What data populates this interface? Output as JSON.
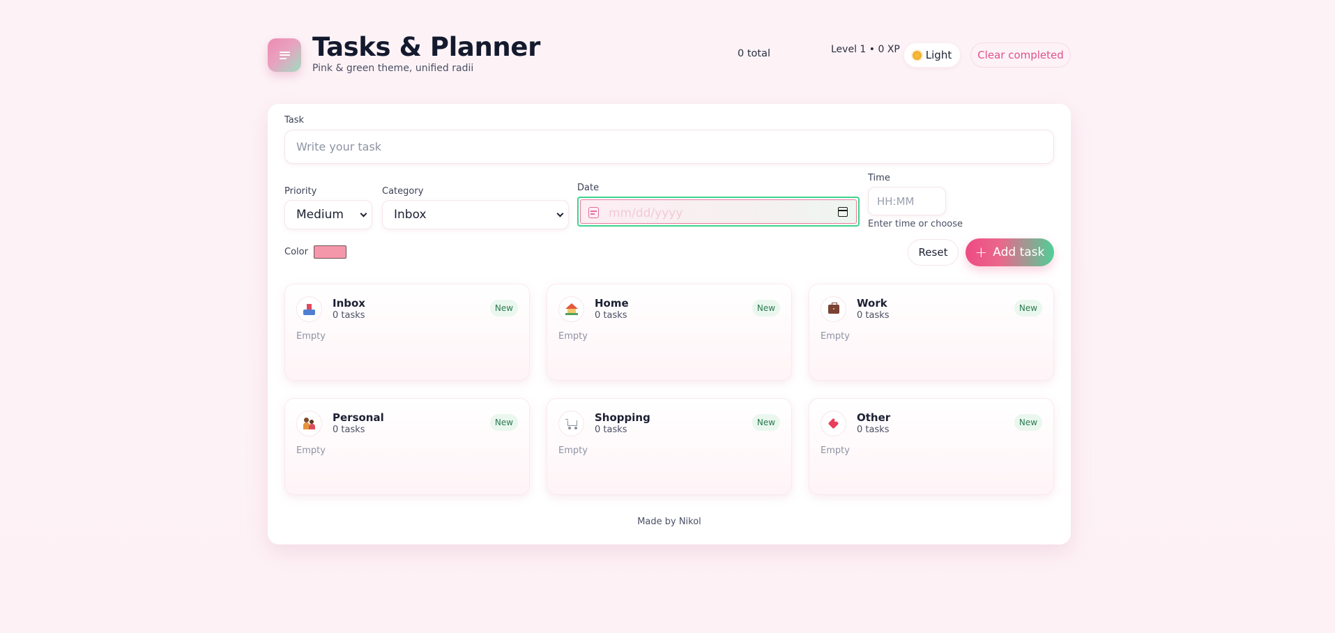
{
  "header": {
    "title": "Tasks & Planner",
    "subtitle": "Pink & green theme, unified radii",
    "total": "0 total",
    "level": "Level 1 • 0 XP",
    "theme_label": "Light",
    "clear_label": "Clear completed"
  },
  "form": {
    "task_label": "Task",
    "task_placeholder": "Write your task",
    "priority_label": "Priority",
    "priority_value": "Medium",
    "category_label": "Category",
    "category_value": "Inbox",
    "date_label": "Date",
    "date_placeholder": "mm/dd/yyyy",
    "time_label": "Time",
    "time_placeholder": "HH:MM",
    "time_hint": "Enter time or choose",
    "color_label": "Color",
    "color_value": "#f597ab",
    "reset_label": "Reset",
    "add_label": "Add task"
  },
  "categories": [
    {
      "name": "Inbox",
      "count": "0 tasks",
      "badge": "New",
      "empty": "Empty",
      "icon": "inbox-tray-icon"
    },
    {
      "name": "Home",
      "count": "0 tasks",
      "badge": "New",
      "empty": "Empty",
      "icon": "house-icon"
    },
    {
      "name": "Work",
      "count": "0 tasks",
      "badge": "New",
      "empty": "Empty",
      "icon": "briefcase-icon"
    },
    {
      "name": "Personal",
      "count": "0 tasks",
      "badge": "New",
      "empty": "Empty",
      "icon": "people-icon"
    },
    {
      "name": "Shopping",
      "count": "0 tasks",
      "badge": "New",
      "empty": "Empty",
      "icon": "cart-icon"
    },
    {
      "name": "Other",
      "count": "0 tasks",
      "badge": "New",
      "empty": "Empty",
      "icon": "tag-icon"
    }
  ],
  "footer": "Made by Nikol",
  "colors": {
    "accent_pink": "#ee4b84",
    "accent_green": "#4fcf97",
    "date_focus_border": "#3ed38c"
  }
}
